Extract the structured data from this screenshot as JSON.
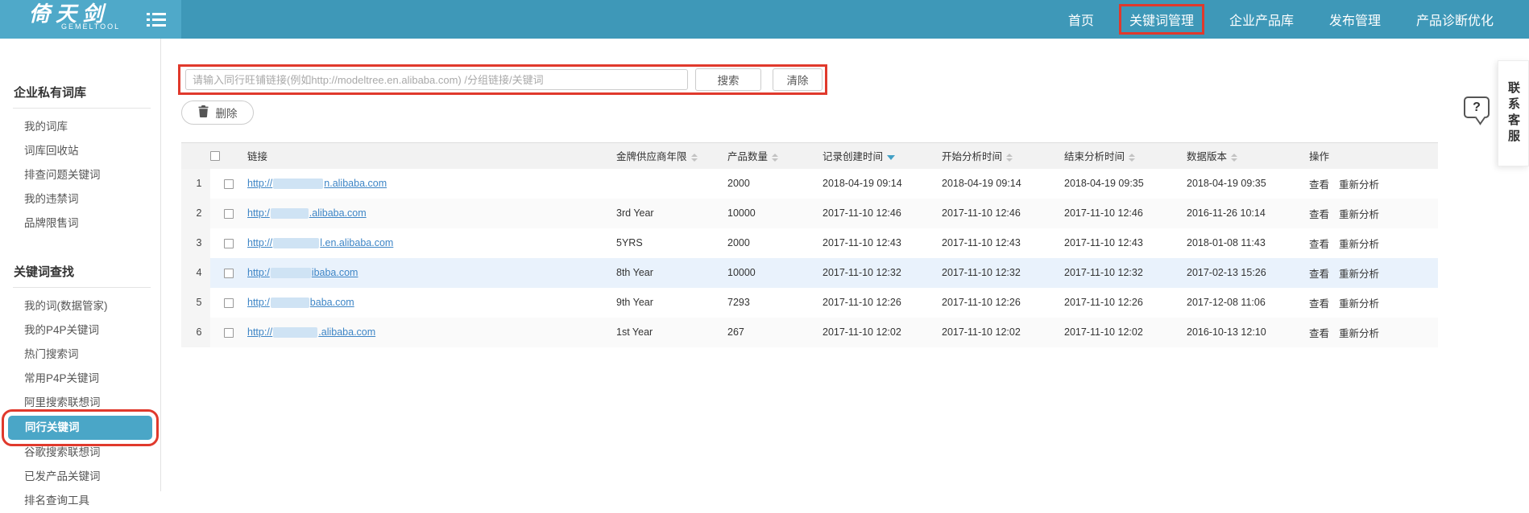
{
  "header": {
    "logo": {
      "title": "倚天剑",
      "subtitle": "GEMELTOOL"
    },
    "nav": [
      {
        "label": "首页",
        "highlighted": false
      },
      {
        "label": "关键词管理",
        "highlighted": true
      },
      {
        "label": "企业产品库",
        "highlighted": false
      },
      {
        "label": "发布管理",
        "highlighted": false
      },
      {
        "label": "产品诊断优化",
        "highlighted": false
      }
    ]
  },
  "sidebar": {
    "sections": [
      {
        "title": "企业私有词库",
        "items": [
          {
            "label": "我的词库"
          },
          {
            "label": "词库回收站"
          },
          {
            "label": "排查问题关键词"
          },
          {
            "label": "我的违禁词"
          },
          {
            "label": "品牌限售词"
          }
        ]
      },
      {
        "title": "关键词查找",
        "items": [
          {
            "label": "我的词(数据管家)"
          },
          {
            "label": "我的P4P关键词"
          },
          {
            "label": "热门搜索词"
          },
          {
            "label": "常用P4P关键词"
          },
          {
            "label": "阿里搜索联想词"
          },
          {
            "label": "同行关键词",
            "selected": true
          },
          {
            "label": "谷歌搜索联想词"
          },
          {
            "label": "已发产品关键词"
          },
          {
            "label": "排名查询工具"
          }
        ]
      }
    ]
  },
  "search": {
    "placeholder": "请输入同行旺铺链接(例如http://modeltree.en.alibaba.com) /分组链接/关键词",
    "value": "",
    "search_label": "搜索",
    "clear_label": "清除"
  },
  "toolbar": {
    "delete_label": "删除"
  },
  "help": {
    "bubble_text": "?",
    "contact_label": "联系客服"
  },
  "table": {
    "columns": [
      {
        "key": "link",
        "label": "链接",
        "sort": "none"
      },
      {
        "key": "year",
        "label": "金牌供应商年限",
        "sort": "both"
      },
      {
        "key": "products",
        "label": "产品数量",
        "sort": "both"
      },
      {
        "key": "created",
        "label": "记录创建时间",
        "sort": "desc"
      },
      {
        "key": "start",
        "label": "开始分析时间",
        "sort": "both"
      },
      {
        "key": "end",
        "label": "结束分析时间",
        "sort": "both"
      },
      {
        "key": "version",
        "label": "数据版本",
        "sort": "both"
      },
      {
        "key": "ops",
        "label": "操作",
        "sort": "none"
      }
    ],
    "action_labels": [
      "查看",
      "重新分析"
    ],
    "rows": [
      {
        "num": "1",
        "link_prefix": "http://",
        "redact_width": 62,
        "link_suffix": "n.alibaba.com",
        "year": "",
        "products": "2000",
        "created": "2018-04-19 09:14",
        "start": "2018-04-19 09:14",
        "end": "2018-04-19 09:35",
        "version": "2018-04-19 09:35",
        "highlighted": false
      },
      {
        "num": "2",
        "link_prefix": "http:/",
        "redact_width": 47,
        "link_suffix": ".alibaba.com",
        "year": "3rd Year",
        "products": "10000",
        "created": "2017-11-10 12:46",
        "start": "2017-11-10 12:46",
        "end": "2017-11-10 12:46",
        "version": "2016-11-26 10:14",
        "highlighted": false
      },
      {
        "num": "3",
        "link_prefix": "http://",
        "redact_width": 57,
        "link_suffix": "l.en.alibaba.com",
        "year": "5YRS",
        "products": "2000",
        "created": "2017-11-10 12:43",
        "start": "2017-11-10 12:43",
        "end": "2017-11-10 12:43",
        "version": "2018-01-08 11:43",
        "highlighted": false
      },
      {
        "num": "4",
        "link_prefix": "http:/",
        "redact_width": 50,
        "link_suffix": "ibaba.com",
        "year": "8th Year",
        "products": "10000",
        "created": "2017-11-10 12:32",
        "start": "2017-11-10 12:32",
        "end": "2017-11-10 12:32",
        "version": "2017-02-13 15:26",
        "highlighted": true
      },
      {
        "num": "5",
        "link_prefix": "http:/",
        "redact_width": 48,
        "link_suffix": "baba.com",
        "year": "9th Year",
        "products": "7293",
        "created": "2017-11-10 12:26",
        "start": "2017-11-10 12:26",
        "end": "2017-11-10 12:26",
        "version": "2017-12-08 11:06",
        "highlighted": false
      },
      {
        "num": "6",
        "link_prefix": "http://",
        "redact_width": 55,
        "link_suffix": ".alibaba.com",
        "year": "1st Year",
        "products": "267",
        "created": "2017-11-10 12:02",
        "start": "2017-11-10 12:02",
        "end": "2017-11-10 12:02",
        "version": "2016-10-13 12:10",
        "highlighted": false
      }
    ]
  },
  "colors": {
    "header_bg": "#3e98b8",
    "logo_bg": "#4fa9c9",
    "accent_teal": "#4aa6c7",
    "annotation_red": "#e0392c",
    "link_blue": "#3d85c6",
    "sort_active": "#42a0c5"
  }
}
